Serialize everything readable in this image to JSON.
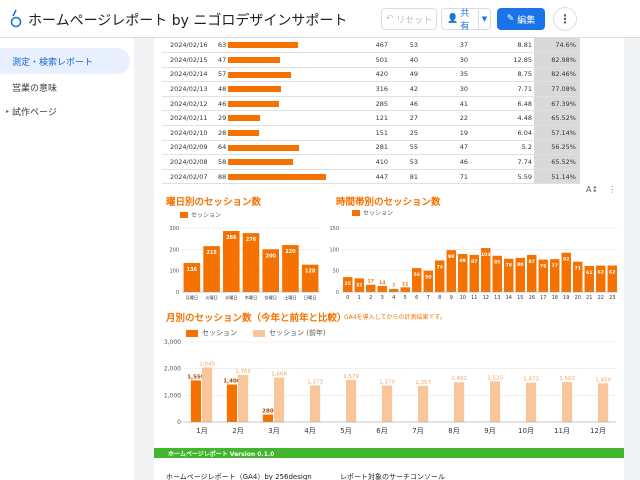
{
  "header": {
    "title": "ホームページレポート by ニゴロデザインサポート",
    "reset_label": "リセット",
    "share_label": "共有",
    "edit_label": "編集"
  },
  "sidebar": {
    "items": [
      {
        "label": "測定・検索レポート"
      },
      {
        "label": "営業の意味"
      },
      {
        "label": "試作ページ"
      }
    ]
  },
  "table": {
    "rows": [
      {
        "date": "2024/02/16",
        "sessions": 63,
        "v1": "467",
        "v2": "53",
        "v3": "37",
        "v4": "8.81",
        "pct": "74.6%"
      },
      {
        "date": "2024/02/15",
        "sessions": 47,
        "v1": "501",
        "v2": "40",
        "v3": "30",
        "v4": "12.85",
        "pct": "82.98%"
      },
      {
        "date": "2024/02/14",
        "sessions": 57,
        "v1": "420",
        "v2": "49",
        "v3": "35",
        "v4": "8.75",
        "pct": "82.46%"
      },
      {
        "date": "2024/02/13",
        "sessions": 48,
        "v1": "316",
        "v2": "42",
        "v3": "30",
        "v4": "7.71",
        "pct": "77.08%"
      },
      {
        "date": "2024/02/12",
        "sessions": 46,
        "v1": "285",
        "v2": "46",
        "v3": "41",
        "v4": "6.48",
        "pct": "67.39%"
      },
      {
        "date": "2024/02/11",
        "sessions": 29,
        "v1": "121",
        "v2": "27",
        "v3": "22",
        "v4": "4.48",
        "pct": "65.52%"
      },
      {
        "date": "2024/02/10",
        "sessions": 28,
        "v1": "151",
        "v2": "25",
        "v3": "19",
        "v4": "6.04",
        "pct": "57.14%"
      },
      {
        "date": "2024/02/09",
        "sessions": 64,
        "v1": "281",
        "v2": "55",
        "v3": "47",
        "v4": "5.2",
        "pct": "56.25%"
      },
      {
        "date": "2024/02/08",
        "sessions": 58,
        "v1": "410",
        "v2": "53",
        "v3": "46",
        "v4": "7.74",
        "pct": "65.52%"
      },
      {
        "date": "2024/02/07",
        "sessions": 88,
        "v1": "447",
        "v2": "81",
        "v3": "71",
        "v4": "5.59",
        "pct": "51.14%"
      }
    ]
  },
  "sections": {
    "weekday_title": "曜日別のセッション数",
    "hour_title": "時間帯別のセッション数",
    "monthly_title": "月別のセッション数（今年と前年と比較）",
    "monthly_note": "GA4を導入してからの計測結果です。",
    "legend_session": "セッション",
    "legend_prev": "セッション (前年)"
  },
  "footer": {
    "band_label": "ホームページレポート Version 0.1.0",
    "left_text": "ホームページレポート（GA4）by 256design",
    "right_text": "レポート対象のサーチコンソール"
  },
  "colors": {
    "accent": "#f57200",
    "accent_light": "#f9c59b",
    "band": "#41b52c",
    "primary": "#1a73e8"
  },
  "chart_data": [
    {
      "type": "bar",
      "title": "曜日別のセッション数",
      "categories": [
        "月曜日",
        "火曜日",
        "水曜日",
        "木曜日",
        "金曜日",
        "土曜日",
        "日曜日"
      ],
      "values": [
        136,
        215,
        286,
        276,
        200,
        220,
        128
      ],
      "ylim": [
        0,
        300
      ],
      "yticks": [
        0,
        100,
        200,
        300
      ],
      "series": [
        {
          "name": "セッション",
          "values": [
            136,
            215,
            286,
            276,
            200,
            220,
            128
          ]
        }
      ]
    },
    {
      "type": "bar",
      "title": "時間帯別のセッション数",
      "categories": [
        "0",
        "1",
        "2",
        "3",
        "4",
        "5",
        "6",
        "7",
        "8",
        "9",
        "10",
        "11",
        "12",
        "13",
        "14",
        "15",
        "16",
        "17",
        "18",
        "19",
        "20",
        "21",
        "22",
        "23"
      ],
      "values": [
        35,
        32,
        17,
        14,
        7,
        11,
        56,
        50,
        74,
        98,
        89,
        87,
        103,
        85,
        78,
        80,
        87,
        76,
        77,
        92,
        71,
        61,
        62,
        62
      ],
      "ylim": [
        0,
        150
      ],
      "yticks": [
        0,
        50,
        100,
        150
      ],
      "series": [
        {
          "name": "セッション",
          "values": [
            35,
            32,
            17,
            14,
            7,
            11,
            56,
            50,
            74,
            98,
            89,
            87,
            103,
            85,
            78,
            80,
            87,
            76,
            77,
            92,
            71,
            61,
            62,
            62
          ]
        }
      ]
    },
    {
      "type": "bar",
      "title": "月別のセッション数（今年と前年と比較）",
      "categories": [
        "1月",
        "2月",
        "3月",
        "4月",
        "5月",
        "6月",
        "7月",
        "8月",
        "9月",
        "10月",
        "11月",
        "12月"
      ],
      "ylim": [
        0,
        3000
      ],
      "yticks": [
        0,
        1000,
        2000,
        3000
      ],
      "series": [
        {
          "name": "セッション",
          "values": [
            1559,
            1406,
            280,
            null,
            null,
            null,
            null,
            null,
            null,
            null,
            null,
            null
          ]
        },
        {
          "name": "セッション (前年)",
          "values": [
            2045,
            1765,
            1666,
            1373,
            1579,
            1370,
            1357,
            1492,
            1525,
            1473,
            1502,
            1450
          ]
        }
      ]
    }
  ]
}
